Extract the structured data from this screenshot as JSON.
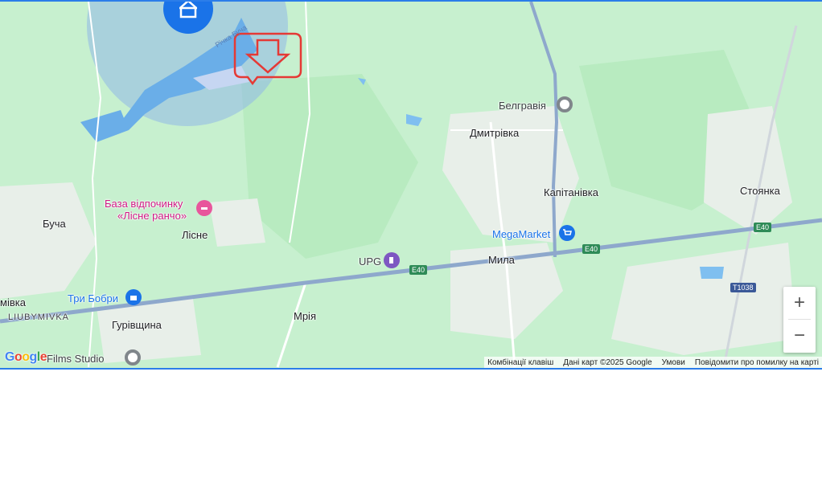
{
  "map": {
    "labels": {
      "belhravia": "Белгравія",
      "dmytrivka": "Дмитрівка",
      "kapitanivka": "Капітанівка",
      "stoianka": "Стоянка",
      "megamarket": "MegaMarket",
      "mila": "Мила",
      "upg": "UPG",
      "buча": "Буча",
      "base_line1": "База відпочинку",
      "base_line2": "«Лісне ранчо»",
      "lisne": "Лісне",
      "try_bobry": "Три Бобри",
      "mriia": "Мрія",
      "liubymivka_caps": "LIUBYMIVKA",
      "hurivshchyna": "Гурівщина",
      "ivka": "мівка",
      "films_studio": "Films Studio",
      "river": "Річка Буча"
    },
    "shields": {
      "e40_a": "E40",
      "e40_b": "E40",
      "e40_c": "E40",
      "t1038": "T1038"
    },
    "colors": {
      "land": "#c7f0cf",
      "forest": "#b5e8bd",
      "water": "#7fbff0",
      "urban": "#eef1ee",
      "road": "#8ea8cc",
      "highlight": "#e53935"
    },
    "icons": {
      "location": "home-icon",
      "highlight": "arrow-down-icon"
    }
  },
  "zoom": {
    "in": "+",
    "out": "−"
  },
  "footer": {
    "shortcuts": "Комбінації клавіш",
    "data": "Дані карт ©2025 Google",
    "terms": "Умови",
    "report": "Повідомити про помилку на карті"
  },
  "logo": {
    "text": "Google"
  }
}
